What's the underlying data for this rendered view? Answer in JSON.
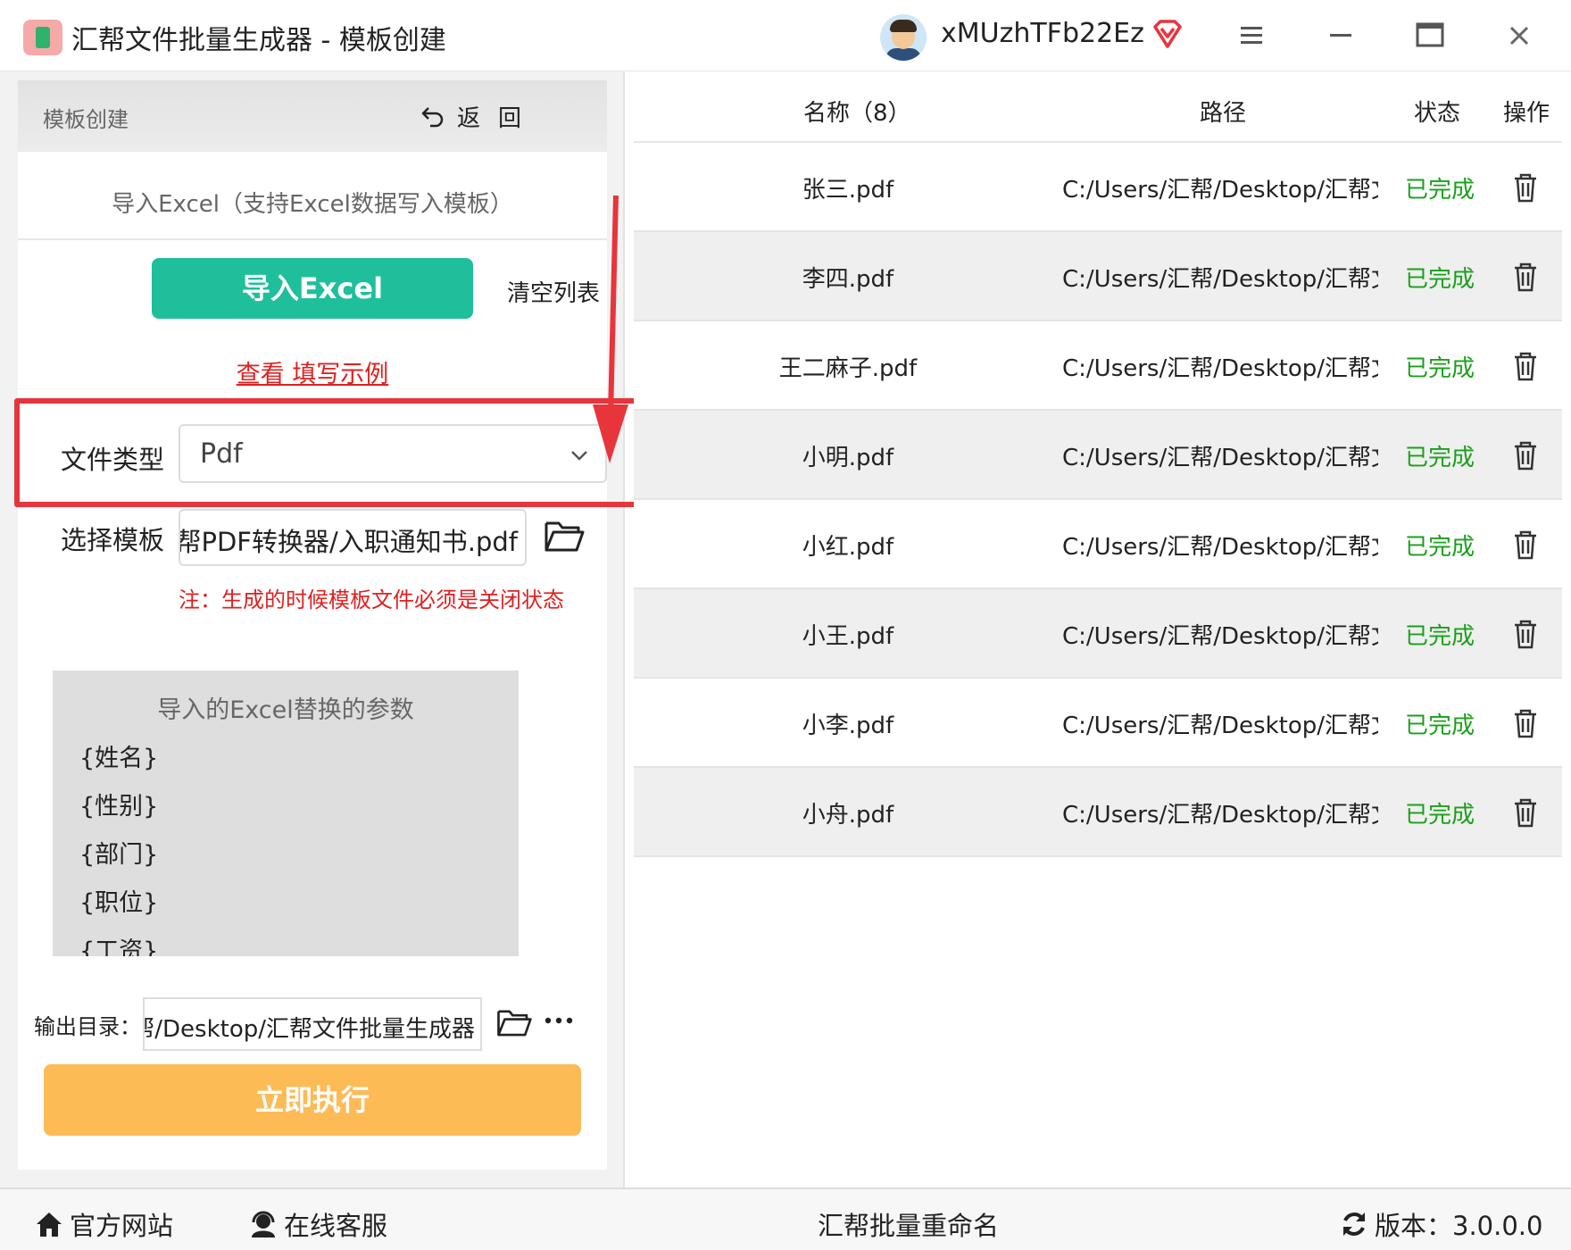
{
  "window": {
    "title": "汇帮文件批量生成器 - 模板创建",
    "username": "xMUzhTFb22Ez"
  },
  "panel": {
    "header_title": "模板创建",
    "back_label": "返回",
    "import_desc": "导入Excel（支持Excel数据写入模板）",
    "import_button": "导入Excel",
    "clear_list": "清空列表",
    "example_link": "查看 填写示例",
    "file_type_label": "文件类型",
    "file_type_value": "Pdf",
    "template_label": "选择模板",
    "template_value": "汇帮PDF转换器/入职通知书.pdf",
    "note": "注：生成的时候模板文件必须是关闭状态",
    "params_title": "导入的Excel替换的参数",
    "params": [
      "{姓名}",
      "{性别}",
      "{部门}",
      "{职位}",
      "{工资}"
    ],
    "output_label": "输出目录：",
    "output_value": "汇帮/Desktop/汇帮文件批量生成器",
    "run_button": "立即执行"
  },
  "table": {
    "headers": {
      "name": "名称（8）",
      "path": "路径",
      "status": "状态",
      "action": "操作"
    },
    "rows": [
      {
        "name": "张三.pdf",
        "path": "C:/Users/汇帮/Desktop/汇帮文件",
        "status": "已完成"
      },
      {
        "name": "李四.pdf",
        "path": "C:/Users/汇帮/Desktop/汇帮文件",
        "status": "已完成"
      },
      {
        "name": "王二麻子.pdf",
        "path": "C:/Users/汇帮/Desktop/汇帮文件",
        "status": "已完成"
      },
      {
        "name": "小明.pdf",
        "path": "C:/Users/汇帮/Desktop/汇帮文件",
        "status": "已完成"
      },
      {
        "name": "小红.pdf",
        "path": "C:/Users/汇帮/Desktop/汇帮文件",
        "status": "已完成"
      },
      {
        "name": "小王.pdf",
        "path": "C:/Users/汇帮/Desktop/汇帮文件",
        "status": "已完成"
      },
      {
        "name": "小李.pdf",
        "path": "C:/Users/汇帮/Desktop/汇帮文件",
        "status": "已完成"
      },
      {
        "name": "小舟.pdf",
        "path": "C:/Users/汇帮/Desktop/汇帮文件",
        "status": "已完成"
      }
    ]
  },
  "footer": {
    "official_site": "官方网站",
    "online_service": "在线客服",
    "center": "汇帮批量重命名",
    "version": "版本：3.0.0.0"
  },
  "colors": {
    "accent_green": "#1fbf9c",
    "run_orange": "#fdbb56",
    "status_green": "#1aa01a",
    "highlight_red": "#e8343b",
    "link_red": "#e02020"
  },
  "icons": [
    "app-logo-icon",
    "avatar",
    "vip-diamond-icon",
    "menu-icon",
    "minimize-icon",
    "maximize-icon",
    "close-icon",
    "back-arrow-icon",
    "chevron-down-icon",
    "folder-icon",
    "more-icon",
    "trash-icon",
    "home-icon",
    "headset-icon",
    "refresh-icon"
  ]
}
